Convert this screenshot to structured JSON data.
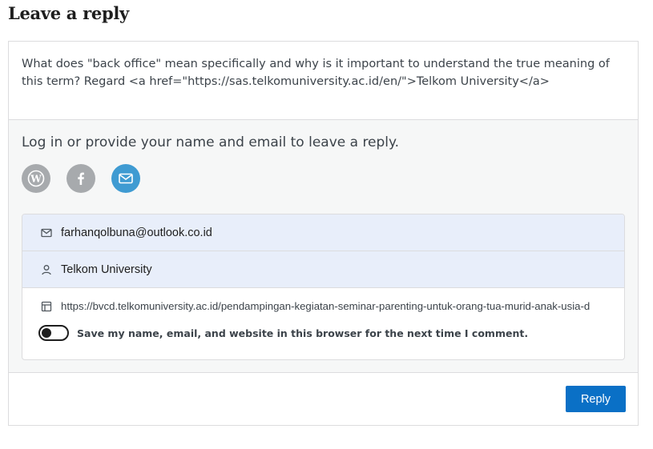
{
  "heading": "Leave a reply",
  "comment": {
    "text": "What does \"back office\" mean specifically and why is it important to understand the true meaning of this term? Regard <a href=\"https://sas.telkomuniversity.ac.id/en/\">Telkom University</a>"
  },
  "identity": {
    "prompt": "Log in or provide your name and email to leave a reply.",
    "social": [
      {
        "icon": "wordpress-icon",
        "color": "#a7aaad"
      },
      {
        "icon": "facebook-icon",
        "color": "#a7aaad"
      },
      {
        "icon": "email-icon",
        "color": "#3f9bd2"
      }
    ],
    "email_value": "farhanqolbuna@outlook.co.id",
    "name_value": "Telkom University",
    "website_value": "https://bvcd.telkomuniversity.ac.id/pendampingan-kegiatan-seminar-parenting-untuk-orang-tua-murid-anak-usia-d",
    "save_label": "Save my name, email, and website in this browser for the next time I comment.",
    "save_checked": false
  },
  "reply_button": "Reply",
  "colors": {
    "accent": "#0a70c6",
    "field_highlight": "#e8eefa"
  }
}
